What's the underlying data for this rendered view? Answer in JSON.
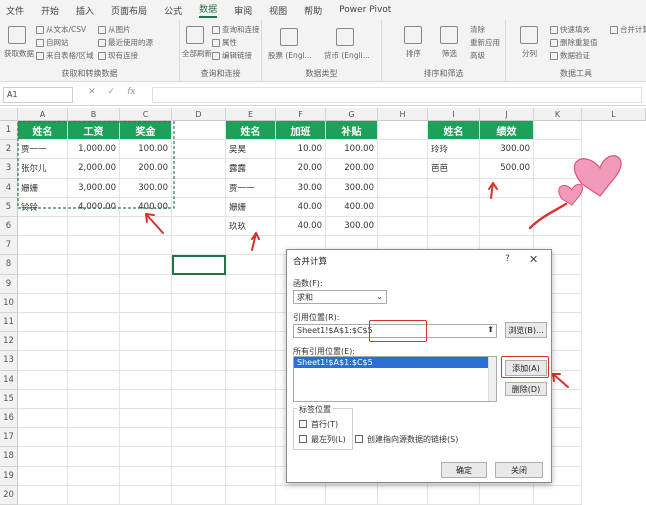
{
  "menu": [
    "文件",
    "开始",
    "插入",
    "页面布局",
    "公式",
    "数据",
    "审阅",
    "视图",
    "帮助",
    "Power Pivot"
  ],
  "menu_active_index": 5,
  "ribbon": {
    "g1": {
      "big": "获取数据",
      "items": [
        "从文本/CSV",
        "自网站",
        "来自表格/区域"
      ],
      "items2": [
        "从图片",
        "最近使用的源",
        "现有连接"
      ],
      "label": "获取和转换数据"
    },
    "g2": {
      "big": "全部刷新",
      "items": [
        "查询和连接",
        "属性",
        "编辑链接"
      ],
      "label": "查询和连接"
    },
    "g3": {
      "items": [
        "股票 (Engl...",
        "货币 (Engli..."
      ],
      "label": "数据类型"
    },
    "g4": {
      "items": [
        "排序",
        "筛选",
        "清除",
        "重新应用",
        "高级"
      ],
      "label": "排序和筛选"
    },
    "g5": {
      "items": [
        "分列",
        "快速填充",
        "删除重复值",
        "数据验证",
        "合并计算"
      ],
      "label": "数据工具"
    }
  },
  "formula_bar": {
    "namebox": "A1",
    "cancel": "✕",
    "confirm": "✓",
    "fx": "fx"
  },
  "columns": [
    "A",
    "B",
    "C",
    "D",
    "E",
    "F",
    "G",
    "H",
    "I",
    "J",
    "K",
    "L"
  ],
  "rows": [
    "1",
    "2",
    "3",
    "4",
    "5",
    "6",
    "7",
    "8",
    "9",
    "10",
    "11",
    "12",
    "13",
    "14",
    "15",
    "16",
    "17",
    "18",
    "19",
    "20"
  ],
  "table1": {
    "headers": [
      "姓名",
      "工资",
      "奖金"
    ],
    "rows": [
      [
        "贾一一",
        "1,000.00",
        "100.00"
      ],
      [
        "张尔儿",
        "2,000.00",
        "200.00"
      ],
      [
        "姗姗",
        "3,000.00",
        "300.00"
      ],
      [
        "铃铃",
        "4,000.00",
        "400.00"
      ]
    ]
  },
  "table2": {
    "headers": [
      "姓名",
      "加班",
      "补贴"
    ],
    "rows": [
      [
        "吴昊",
        "10.00",
        "100.00"
      ],
      [
        "露露",
        "20.00",
        "200.00"
      ],
      [
        "贾一一",
        "30.00",
        "300.00"
      ],
      [
        "姗姗",
        "40.00",
        "400.00"
      ],
      [
        "玖玖",
        "40.00",
        "300.00"
      ]
    ]
  },
  "table3": {
    "headers": [
      "姓名",
      "绩效"
    ],
    "rows": [
      [
        "玲玲",
        "300.00"
      ],
      [
        "芭芭",
        "500.00"
      ]
    ]
  },
  "colors": {
    "header_green": "#1ea05a",
    "arrow_red": "#d9312e",
    "selection_blue": "#2a6fd6"
  },
  "dialog": {
    "title": "合并计算",
    "help": "?",
    "close": "✕",
    "function_label": "函数(F):",
    "function_value": "求和",
    "reference_label": "引用位置(R):",
    "reference_value": "Sheet1!$A$1:$C$5",
    "browse_button": "浏览(B)...",
    "all_refs_label": "所有引用位置(E):",
    "all_refs_items": [
      "Sheet1!$A$1:$C$5"
    ],
    "add_button": "添加(A)",
    "delete_button": "删除(D)",
    "label_position": "标签位置",
    "first_row": "首行(T)",
    "left_column": "最左列(L)",
    "create_links": "创建指向源数据的链接(S)",
    "ok_button": "确定",
    "close_button": "关闭"
  }
}
